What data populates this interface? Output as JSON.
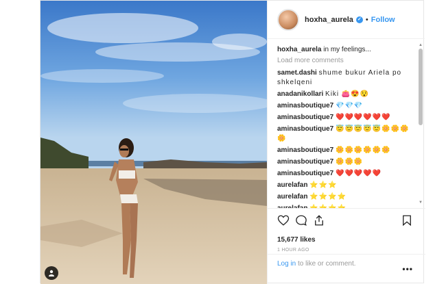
{
  "post": {
    "username": "hoxha_aurela",
    "verified_mark": "✓",
    "follow_dot": "•",
    "follow_label": "Follow",
    "caption_text": "in my feelings...",
    "load_more": "Load more comments",
    "comments": [
      {
        "user": "samet.dashi",
        "text": "shume bukur Ariela po shkelqeni"
      },
      {
        "user": "anadanikollari",
        "text": "Kiki 👛😍😯"
      },
      {
        "user": "aminasboutique7",
        "text": "💎💎💎"
      },
      {
        "user": "aminasboutique7",
        "text": "❤️❤️❤️❤️❤️❤️"
      },
      {
        "user": "aminasboutique7",
        "text": "😇😇😇😇😇🌼🌼🌼🌼"
      },
      {
        "user": "aminasboutique7",
        "text": "🌼🌼🌼🌼🌼🌼"
      },
      {
        "user": "aminasboutique7",
        "text": "🌼🌼🌼"
      },
      {
        "user": "aminasboutique7",
        "text": "❤️❤️❤️❤️❤️"
      },
      {
        "user": "aurelafan",
        "text": "⭐⭐⭐"
      },
      {
        "user": "aurelafan",
        "text": "⭐⭐⭐⭐"
      },
      {
        "user": "aurelafan",
        "text": "⭐⭐⭐⭐"
      }
    ],
    "likes": "15,677 likes",
    "time_ago": "1 HOUR AGO",
    "login_link": "Log in",
    "login_rest": " to like or comment.",
    "more_label": "•••"
  },
  "colors": {
    "accent": "#3897f0",
    "text": "#262626",
    "muted": "#999999",
    "sky": "#4f8fd6",
    "sand": "#d8c4a6"
  },
  "icons": [
    "heart-icon",
    "comment-icon",
    "share-icon",
    "bookmark-icon",
    "person-tag-icon",
    "verified-icon",
    "more-icon"
  ]
}
